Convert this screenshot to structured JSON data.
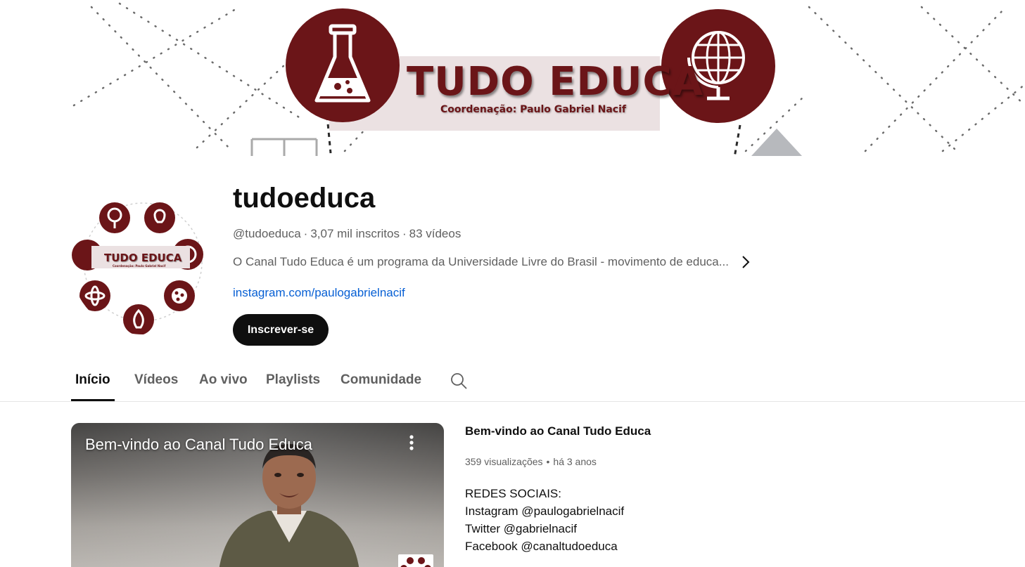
{
  "banner": {
    "title": "TUDO EDUCA",
    "subtitle": "Coordenação: Paulo Gabriel Nacif",
    "brand_color": "#6b1518"
  },
  "channel": {
    "name": "tudoeduca",
    "handle": "@tudoeduca",
    "subscribers": "3,07 mil inscritos",
    "videos": "83 vídeos",
    "description": "O Canal Tudo Educa é um programa da Universidade Livre do Brasil - movimento de educa...",
    "link": "instagram.com/paulogabrielnacif",
    "subscribe_label": "Inscrever-se",
    "avatar_text": "TUDO EDUCA",
    "avatar_subtext": "Coordenação: Paulo Gabriel Nacif"
  },
  "tabs": [
    {
      "label": "Início",
      "active": true
    },
    {
      "label": "Vídeos",
      "active": false
    },
    {
      "label": "Ao vivo",
      "active": false
    },
    {
      "label": "Playlists",
      "active": false
    },
    {
      "label": "Comunidade",
      "active": false
    }
  ],
  "featured": {
    "overlay_title": "Bem-vindo ao Canal Tudo Educa",
    "title": "Bem-vindo ao Canal Tudo Educa",
    "views": "359 visualizações",
    "age": "há 3 anos",
    "description_lines": [
      "REDES SOCIAIS:",
      "Instagram @paulogabrielnacif",
      "Twitter @gabrielnacif",
      "Facebook @canaltudoeduca"
    ]
  },
  "icons": {
    "search": "search-icon",
    "chevron": "chevron-right-icon",
    "menu": "more-vert-icon",
    "flask": "flask-icon",
    "globe": "globe-icon"
  }
}
